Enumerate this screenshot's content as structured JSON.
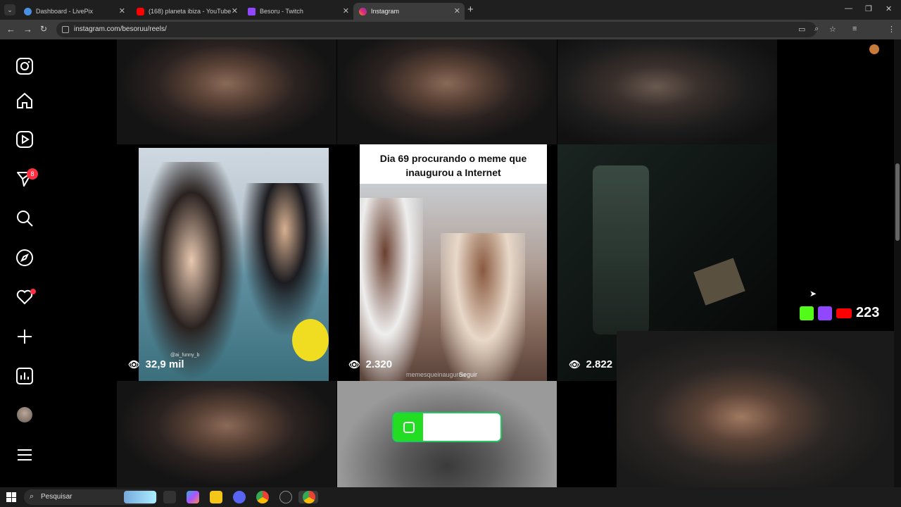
{
  "tabs": [
    {
      "title": "Dashboard - LivePix",
      "color": "#4a90e2"
    },
    {
      "title": "(168) planeta ibiza - YouTube",
      "color": "#ff0000"
    },
    {
      "title": "Besoru - Twitch",
      "color": "#9146ff"
    },
    {
      "title": "Instagram",
      "color": "#e1306c"
    }
  ],
  "url": "instagram.com/besoruu/reels/",
  "sidebar": {
    "notification_badge": "8"
  },
  "reels": [
    {
      "views": "32,9 mil",
      "caption": "@ai_funny_b"
    },
    {
      "views": "2.320",
      "text": "Dia 69 procurando o meme que inaugurou a Internet",
      "account": "memesqueinaugurou",
      "follow": "Seguir"
    },
    {
      "views": "2.822"
    }
  ],
  "overlay": {
    "count": "223"
  },
  "taskbar": {
    "search_placeholder": "Pesquisar"
  }
}
